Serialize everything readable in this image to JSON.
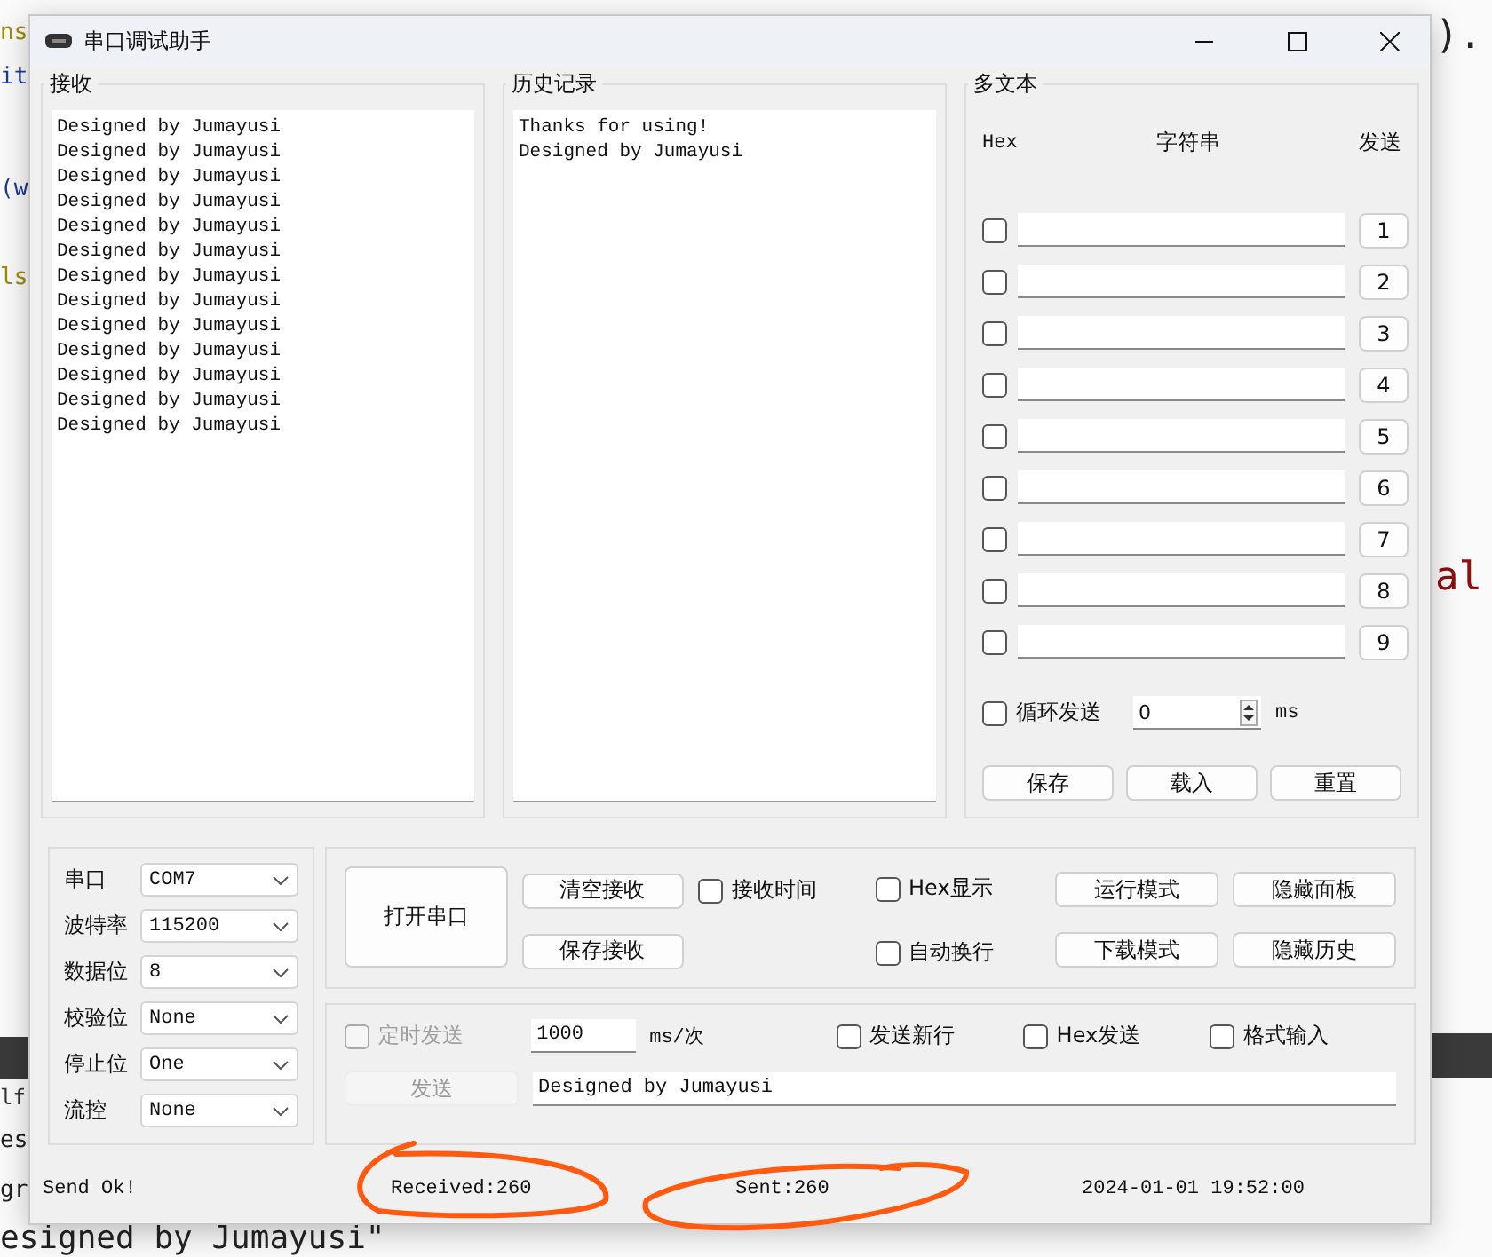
{
  "editor_background": {
    "fragments": [
      {
        "text": "ns",
        "color": "#a08c00"
      },
      {
        "text": ").",
        "color": "#222222"
      },
      {
        "text": "it",
        "color": "#1f3a93"
      },
      {
        "text": "(w",
        "color": "#1f3a93"
      },
      {
        "text": "ls",
        "color": "#a08c00"
      },
      {
        "text": "al",
        "color": "#8b1010"
      },
      {
        "text": "lf",
        "color": "#333333"
      },
      {
        "text": "es",
        "color": "#222222"
      },
      {
        "text": "gr",
        "color": "#222222"
      },
      {
        "text": "esigned by Jumayusi\"",
        "color": "#222222"
      }
    ]
  },
  "window": {
    "title": "串口调试助手"
  },
  "receive": {
    "title": "接收",
    "lines": [
      "Designed by Jumayusi",
      "Designed by Jumayusi",
      "Designed by Jumayusi",
      "Designed by Jumayusi",
      "Designed by Jumayusi",
      "Designed by Jumayusi",
      "Designed by Jumayusi",
      "Designed by Jumayusi",
      "Designed by Jumayusi",
      "Designed by Jumayusi",
      "Designed by Jumayusi",
      "Designed by Jumayusi",
      "Designed by Jumayusi"
    ]
  },
  "history": {
    "title": "历史记录",
    "lines": [
      "Thanks for using!",
      "Designed by Jumayusi"
    ]
  },
  "multi_text": {
    "title": "多文本",
    "headers": [
      "Hex",
      "字符串",
      "发送"
    ],
    "rows": [
      {
        "hex": false,
        "button": "1"
      },
      {
        "hex": false,
        "button": "2"
      },
      {
        "hex": false,
        "button": "3"
      },
      {
        "hex": false,
        "button": "4"
      },
      {
        "hex": false,
        "button": "5"
      },
      {
        "hex": false,
        "button": "6"
      },
      {
        "hex": false,
        "button": "7"
      },
      {
        "hex": false,
        "button": "8"
      },
      {
        "hex": false,
        "button": "9"
      }
    ],
    "loop": {
      "label": "循环发送",
      "checked": false,
      "value": "0",
      "unit": "ms"
    },
    "buttons": [
      "保存",
      "载入",
      "重置"
    ]
  },
  "port_settings": [
    {
      "label": "串口",
      "value": "COM7"
    },
    {
      "label": "波特率",
      "value": "115200"
    },
    {
      "label": "数据位",
      "value": "8"
    },
    {
      "label": "校验位",
      "value": "None"
    },
    {
      "label": "停止位",
      "value": "One"
    },
    {
      "label": "流控",
      "value": "None"
    }
  ],
  "controls": {
    "open_button": "打开串口",
    "clear_button": "清空接收",
    "save_button": "保存接收",
    "receive_time": {
      "label": "接收时间",
      "checked": false
    },
    "hex_display": {
      "label": "Hex显示",
      "checked": false
    },
    "auto_wrap": {
      "label": "自动换行",
      "checked": false
    },
    "mode_buttons": [
      "运行模式",
      "隐藏面板",
      "下载模式",
      "隐藏历史"
    ]
  },
  "send": {
    "timed": {
      "label": "定时发送",
      "checked": false,
      "disabled": true
    },
    "interval": "1000",
    "interval_unit": "ms/次",
    "options": [
      {
        "label": "发送新行",
        "checked": false
      },
      {
        "label": "Hex发送",
        "checked": false
      },
      {
        "label": "格式输入",
        "checked": false
      }
    ],
    "send_button": {
      "label": "发送",
      "disabled": true
    },
    "text": "Designed by Jumayusi"
  },
  "status_bar": [
    "Send Ok!",
    "Received:260",
    "Sent:260",
    "2024-01-01 19:52:00"
  ],
  "ink_marks": [
    {
      "kind": "loop"
    },
    {
      "kind": "loop"
    }
  ]
}
